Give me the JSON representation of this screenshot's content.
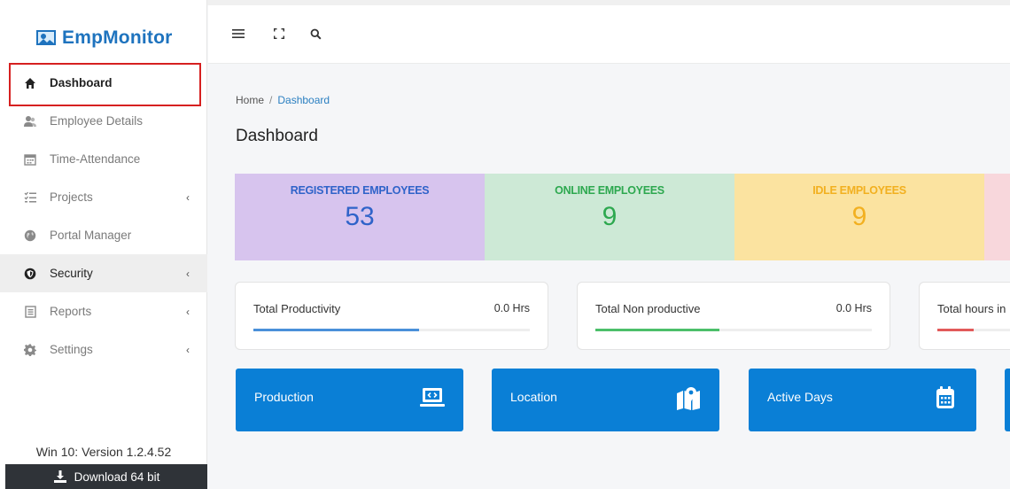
{
  "brand": {
    "name": "EmpMonitor"
  },
  "sidebar": {
    "items": [
      {
        "label": "Dashboard",
        "icon": "home-icon"
      },
      {
        "label": "Employee Details",
        "icon": "users-icon"
      },
      {
        "label": "Time-Attendance",
        "icon": "calendar-icon"
      },
      {
        "label": "Projects",
        "icon": "list-icon",
        "chevron": "‹"
      },
      {
        "label": "Portal Manager",
        "icon": "globe-icon"
      },
      {
        "label": "Security",
        "icon": "shield-icon",
        "chevron": "‹"
      },
      {
        "label": "Reports",
        "icon": "report-icon",
        "chevron": "‹"
      },
      {
        "label": "Settings",
        "icon": "gear-icon",
        "chevron": "‹"
      }
    ],
    "version": "Win 10: Version 1.2.4.52",
    "download": "Download 64 bit"
  },
  "header": {
    "icons": [
      "menu-icon",
      "fullscreen-icon",
      "search-icon"
    ]
  },
  "breadcrumb": {
    "home": "Home",
    "sep": "/",
    "current": "Dashboard"
  },
  "page_title": "Dashboard",
  "stats": [
    {
      "label": "REGISTERED EMPLOYEES",
      "value": "53",
      "bg": "#d7c4ee",
      "color": "#2f63c9"
    },
    {
      "label": "ONLINE EMPLOYEES",
      "value": "9",
      "bg": "#cde9d6",
      "color": "#2da84f"
    },
    {
      "label": "IDLE EMPLOYEES",
      "value": "9",
      "bg": "#fbe3a0",
      "color": "#f2b020"
    }
  ],
  "productivity": [
    {
      "title": "Total Productivity",
      "value": "0.0 Hrs",
      "color": "#4a90d9",
      "progress": 0.6
    },
    {
      "title": "Total Non productive",
      "value": "0.0 Hrs",
      "color": "#4cbf6a",
      "progress": 0.45
    },
    {
      "title": "Total hours in",
      "value": "",
      "color": "#e25a5a",
      "progress": 0.5
    }
  ],
  "tiles": [
    {
      "label": "Production",
      "icon": "monitor-code-icon"
    },
    {
      "label": "Location",
      "icon": "map-icon"
    },
    {
      "label": "Active Days",
      "icon": "calendar-icon"
    }
  ]
}
